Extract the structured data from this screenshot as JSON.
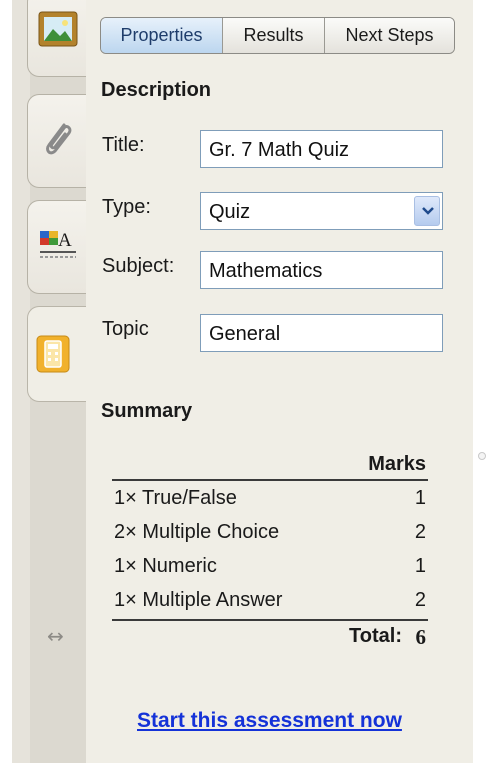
{
  "tabs": {
    "properties": "Properties",
    "results": "Results",
    "next_steps": "Next Steps"
  },
  "sidebar": {
    "items": [
      {
        "icon": "image-icon"
      },
      {
        "icon": "paperclip-icon"
      },
      {
        "icon": "text-format-icon"
      },
      {
        "icon": "calculator-icon"
      }
    ],
    "resize_glyph": "↔"
  },
  "description": {
    "title": "Description",
    "fields": {
      "title_label": "Title:",
      "title_value": "Gr. 7 Math Quiz",
      "type_label": "Type:",
      "type_value": "Quiz",
      "subject_label": "Subject:",
      "subject_value": "Mathematics",
      "topic_label": "Topic",
      "topic_value": "General"
    }
  },
  "summary": {
    "title": "Summary",
    "marks_header": "Marks",
    "rows": [
      {
        "label": "1× True/False",
        "marks": "1"
      },
      {
        "label": "2× Multiple Choice",
        "marks": "2"
      },
      {
        "label": "1× Numeric",
        "marks": "1"
      },
      {
        "label": "1× Multiple Answer",
        "marks": "2"
      }
    ],
    "total_label": "Total:",
    "total_value": "6"
  },
  "start_link": "Start this assessment now",
  "colors": {
    "link": "#1432d8",
    "selected_tab": "#bcd6ef",
    "panel_bg": "#f0eee6",
    "sidebar_bg": "#dcd9d0"
  }
}
